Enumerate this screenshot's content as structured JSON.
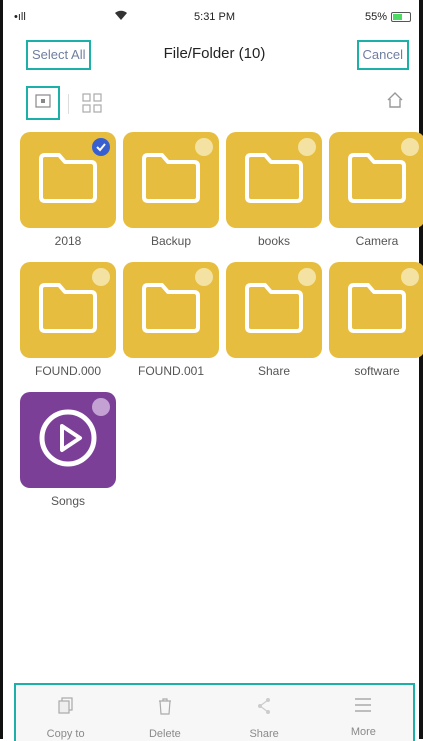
{
  "status_bar": {
    "carrier": "•ıll",
    "time": "5:31 PM",
    "battery_percent": "55%",
    "battery_level": 0.55
  },
  "header": {
    "select_all": "Select All",
    "title": "File/Folder (10)",
    "cancel": "Cancel"
  },
  "toolbar": {
    "list_view_icon": "list-view-icon",
    "grid_view_icon": "grid-view-icon",
    "home_icon": "home-icon"
  },
  "items": [
    {
      "name": "2018",
      "type": "folder",
      "selected": true
    },
    {
      "name": "Backup",
      "type": "folder",
      "selected": false
    },
    {
      "name": "books",
      "type": "folder",
      "selected": false
    },
    {
      "name": "Camera",
      "type": "folder",
      "selected": false
    },
    {
      "name": "FOUND.000",
      "type": "folder",
      "selected": false
    },
    {
      "name": "FOUND.001",
      "type": "folder",
      "selected": false
    },
    {
      "name": "Share",
      "type": "folder",
      "selected": false
    },
    {
      "name": "software",
      "type": "folder",
      "selected": false
    },
    {
      "name": "Songs",
      "type": "music",
      "selected": false
    }
  ],
  "bottom_bar": [
    {
      "label": "Copy to",
      "icon": "copy-icon"
    },
    {
      "label": "Delete",
      "icon": "trash-icon"
    },
    {
      "label": "Share",
      "icon": "share-icon"
    },
    {
      "label": "More",
      "icon": "more-icon"
    }
  ],
  "colors": {
    "accent": "#1cb0a8",
    "folder": "#e6bd3e",
    "music": "#7b3f98",
    "check": "#2e5bd8"
  }
}
